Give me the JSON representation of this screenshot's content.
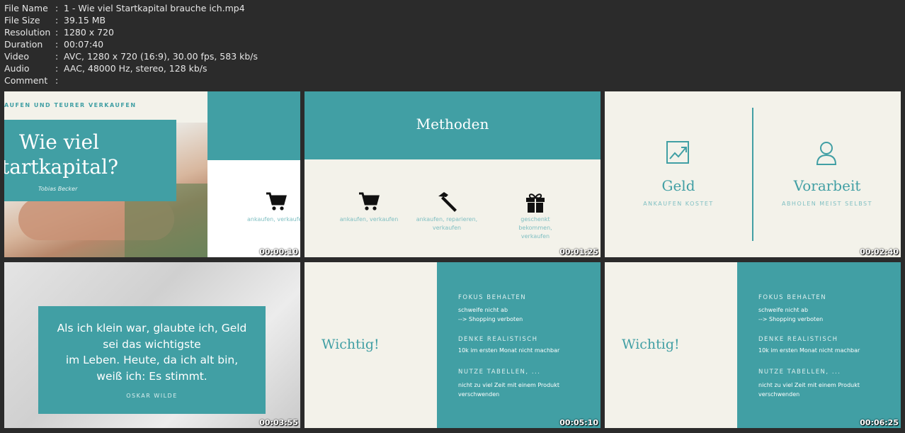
{
  "info": {
    "rows": [
      {
        "key": "File Name",
        "value": "1 - Wie viel Startkapital brauche ich.mp4"
      },
      {
        "key": "File Size",
        "value": "39.15 MB"
      },
      {
        "key": "Resolution",
        "value": "1280 x 720"
      },
      {
        "key": "Duration",
        "value": "00:07:40"
      },
      {
        "key": "Video",
        "value": "AVC, 1280 x 720 (16:9), 30.00 fps, 583 kb/s"
      },
      {
        "key": "Audio",
        "value": "AAC, 48000 Hz, stereo, 128 kb/s"
      },
      {
        "key": "Comment",
        "value": ""
      }
    ]
  },
  "thumbs": {
    "t1": {
      "timestamp": "00:00:10",
      "header": "AUFEN UND TEURER VERKAUFEN",
      "title_line1": "Wie viel",
      "title_line2": "tartkapital?",
      "author": "Tobias Becker",
      "cart_label": "ankaufen, verkaufe"
    },
    "t2": {
      "timestamp": "00:01:25",
      "title": "Methoden",
      "m1": "ankaufen, verkaufen",
      "m2_l1": "ankaufen, reparieren,",
      "m2_l2": "verkaufen",
      "m3_l1": "geschenkt",
      "m3_l2": "bekommen,",
      "m3_l3": "verkaufen"
    },
    "t3": {
      "timestamp": "00:02:40",
      "left_title": "Geld",
      "left_sub": "ANKAUFEN KOSTET",
      "right_title": "Vorarbeit",
      "right_sub": "ABHOLEN MEIST SELBST"
    },
    "t4": {
      "timestamp": "00:03:55",
      "quote_l1": "Als ich klein war, glaubte ich, Geld",
      "quote_l2": "sei das wichtigste",
      "quote_l3": "im Leben. Heute, da ich alt bin,",
      "quote_l4": "weiß ich: Es stimmt.",
      "author": "OSKAR WILDE"
    },
    "t5": {
      "timestamp": "00:05:10",
      "title": "Wichtig!",
      "h1": "FOKUS BEHALTEN",
      "h1_a": "schweife nicht ab",
      "h1_b": "--> Shopping verboten",
      "h2": "DENKE REALISTISCH",
      "h2_a": "10k im ersten Monat nicht machbar",
      "h3": "NUTZE TABELLEN, ...",
      "h3_a": "nicht zu viel Zeit mit einem Produkt",
      "h3_b": "verschwenden"
    },
    "t6": {
      "timestamp": "00:06:25",
      "title": "Wichtig!",
      "h1": "FOKUS BEHALTEN",
      "h1_a": "schweife nicht ab",
      "h1_b": "--> Shopping verboten",
      "h2": "DENKE REALISTISCH",
      "h2_a": "10k im ersten Monat nicht machbar",
      "h3": "NUTZE TABELLEN, ...",
      "h3_a": "nicht zu viel Zeit mit einem Produkt",
      "h3_b": "verschwenden"
    }
  },
  "colors": {
    "teal": "#419fa4",
    "cream": "#f3f2ea",
    "background": "#2b2b2b"
  },
  "icons": [
    "cart-icon",
    "hammer-icon",
    "gift-icon",
    "chart-icon",
    "user-icon"
  ]
}
